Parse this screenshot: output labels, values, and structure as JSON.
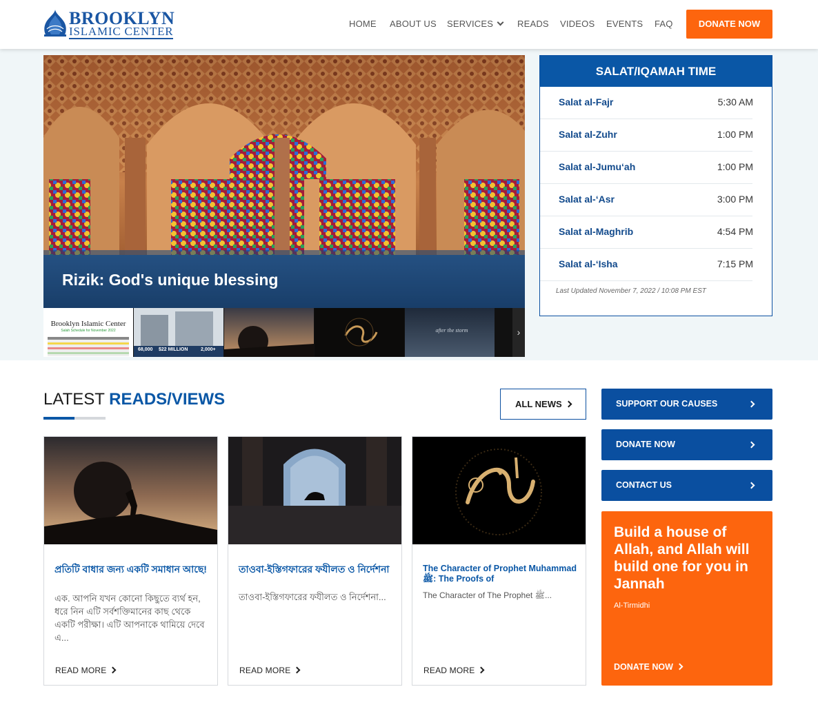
{
  "brand": {
    "line1": "BROOKLYN",
    "line2": "ISLAMIC CENTER",
    "logo_icon": "mosque-dome-icon"
  },
  "nav": {
    "items": [
      "HOME",
      "ABOUT US",
      "SERVICES",
      "READS",
      "VIDEOS",
      "EVENTS",
      "FAQ"
    ],
    "donate_label": "DONATE NOW"
  },
  "hero": {
    "title": "Rizik: God's unique blessing",
    "thumbnails": [
      {
        "text": "Brooklyn Islamic Center",
        "sub": "Salah Schedule for November 2022"
      },
      {
        "stats": [
          "68,000",
          "$22 MILLION",
          "2,000+"
        ]
      },
      {},
      {},
      {
        "text": "after the storm"
      }
    ]
  },
  "salat": {
    "heading": "SALAT/IQAMAH TIME",
    "rows": [
      {
        "name": "Salat al-Fajr",
        "time": "5:30 AM"
      },
      {
        "name": "Salat al-Zuhr",
        "time": "1:00 PM"
      },
      {
        "name": "Salat al-Jumu‘ah",
        "time": "1:00 PM"
      },
      {
        "name": "Salat al-‘Asr",
        "time": "3:00 PM"
      },
      {
        "name": "Salat al-Maghrib",
        "time": "4:54 PM"
      },
      {
        "name": "Salat al-‘Isha",
        "time": "7:15 PM"
      }
    ],
    "updated": "Last Updated November 7, 2022 / 10:08 PM EST"
  },
  "latest": {
    "title_plain": "LATEST ",
    "title_accent": "READS/VIEWS",
    "all_news": "ALL NEWS",
    "cards": [
      {
        "title": "প্রতিটি বাধার জন্য একটি সমাধান আছে!",
        "excerpt": "এক. আপনি যখন কোনো কিছুতে ব্যর্থ হন, ধরে নিন এটি সর্বশক্তিমানের কাছ থেকে একটি পরীক্ষা। এটি আপনাকে থামিয়ে দেবে এ...",
        "more": "READ MORE"
      },
      {
        "title": "তাওবা-ইস্তিগফারের ফযীলত ও নির্দেশনা",
        "excerpt": "তাওবা-ইস্তিগফারের ফযীলত ও নির্দেশনা...",
        "more": "READ MORE"
      },
      {
        "title": "The Character of Prophet Muhammad ﷺ: The Proofs of",
        "excerpt": "The Character of The Prophet ﷺ...",
        "more": "READ MORE"
      }
    ]
  },
  "sidebar": {
    "buttons": [
      "SUPPORT OUR CAUSES",
      "DONATE NOW",
      "CONTACT US"
    ],
    "promo": {
      "text": "Build a house of Allah, and Allah will build one for you in Jannah",
      "source": "Al-Tirmidhi",
      "cta": "DONATE NOW"
    }
  },
  "colors": {
    "brand_blue": "#0a57a6",
    "accent_orange": "#fd650e",
    "band_bg": "#f0f6f8"
  }
}
